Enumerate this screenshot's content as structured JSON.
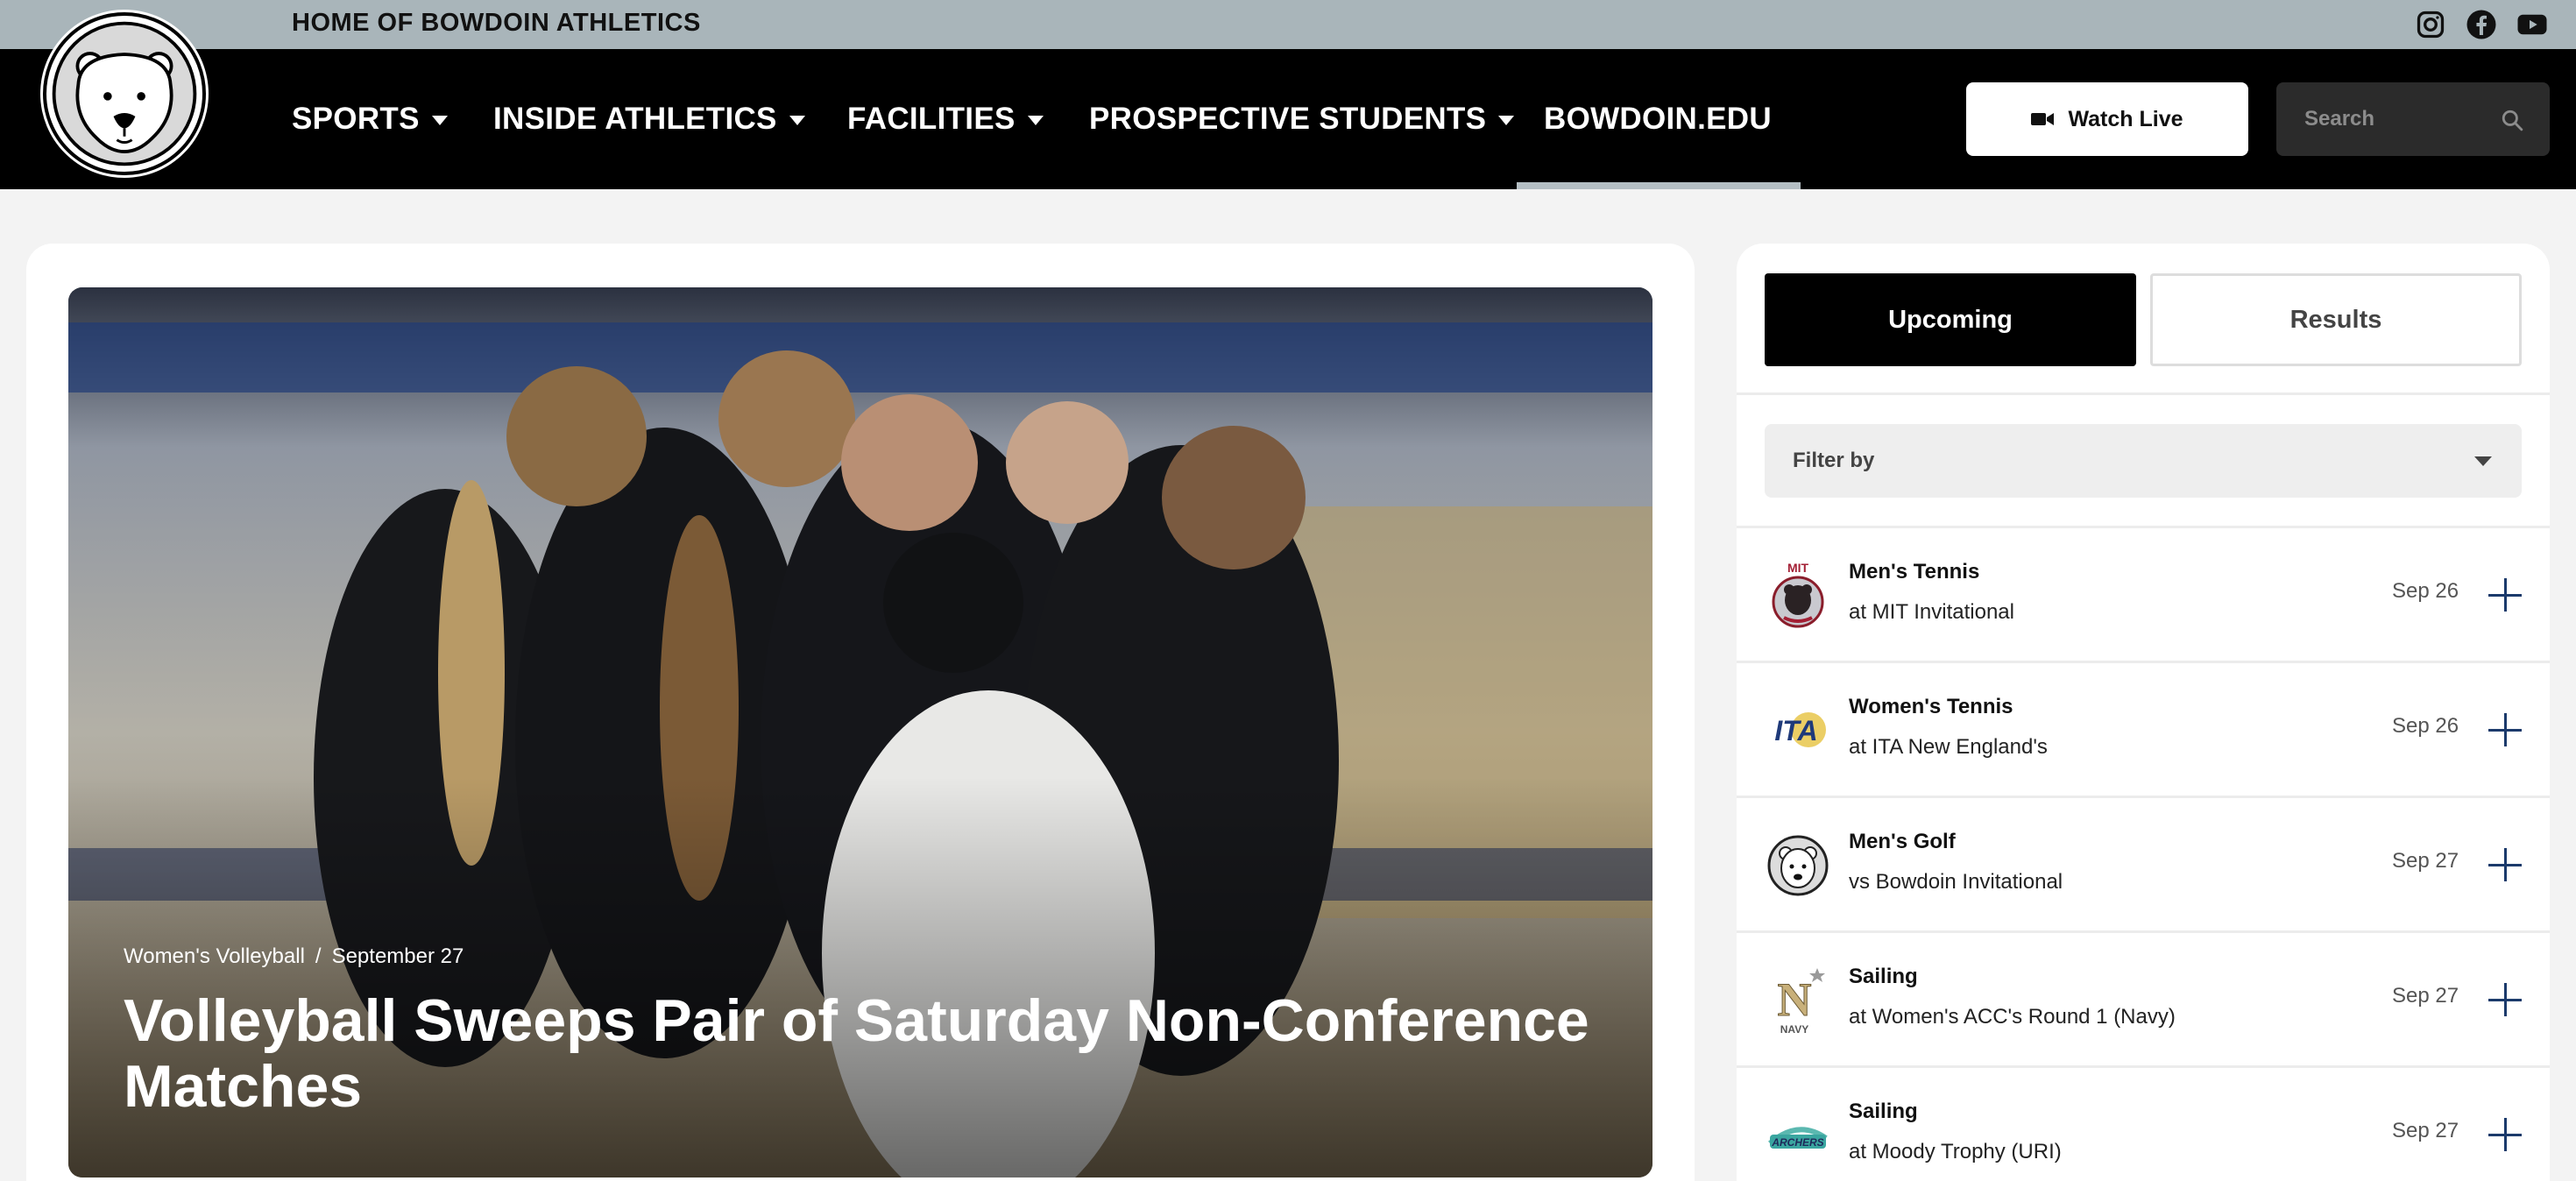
{
  "utility_bar": {
    "title": "HOME OF BOWDOIN ATHLETICS",
    "social": [
      "instagram-icon",
      "facebook-icon",
      "youtube-icon"
    ]
  },
  "nav": {
    "items": [
      {
        "label": "SPORTS",
        "has_dropdown": true
      },
      {
        "label": "INSIDE ATHLETICS",
        "has_dropdown": true
      },
      {
        "label": "FACILITIES",
        "has_dropdown": true
      },
      {
        "label": "PROSPECTIVE STUDENTS",
        "has_dropdown": true
      },
      {
        "label": "BOWDOIN.EDU",
        "has_dropdown": false,
        "active": true
      }
    ],
    "watch_live": {
      "label": "Watch Live",
      "icon": "video-camera-icon"
    },
    "search": {
      "placeholder": "Search",
      "icon": "search-icon"
    }
  },
  "feature": {
    "category": "Women's Volleyball",
    "separator": "/",
    "date": "September 27",
    "title": "Volleyball Sweeps Pair of Saturday Non-Conference Matches"
  },
  "schedule": {
    "tabs": [
      {
        "label": "Upcoming",
        "active": true
      },
      {
        "label": "Results",
        "active": false
      }
    ],
    "filter_label": "Filter by",
    "events": [
      {
        "sport": "Men's Tennis",
        "opponent": "at MIT Invitational",
        "date": "Sep 26",
        "logo": "mit-logo-icon"
      },
      {
        "sport": "Women's Tennis",
        "opponent": "at ITA New England's",
        "date": "Sep 26",
        "logo": "ita-logo-icon"
      },
      {
        "sport": "Men's Golf",
        "opponent": "vs Bowdoin Invitational",
        "date": "Sep 27",
        "logo": "bowdoin-polar-bear-icon"
      },
      {
        "sport": "Sailing",
        "opponent": "at Women's ACC's Round 1 (Navy)",
        "date": "Sep 27",
        "logo": "navy-logo-icon"
      },
      {
        "sport": "Sailing",
        "opponent": "at Moody Trophy (URI)",
        "date": "Sep 27",
        "logo": "archers-logo-icon"
      }
    ]
  },
  "colors": {
    "utility_bar": "#a9b5ba",
    "nav_bg": "#000000",
    "accent_plus": "#1b3a6b",
    "page_bg": "#f3f3f3"
  }
}
